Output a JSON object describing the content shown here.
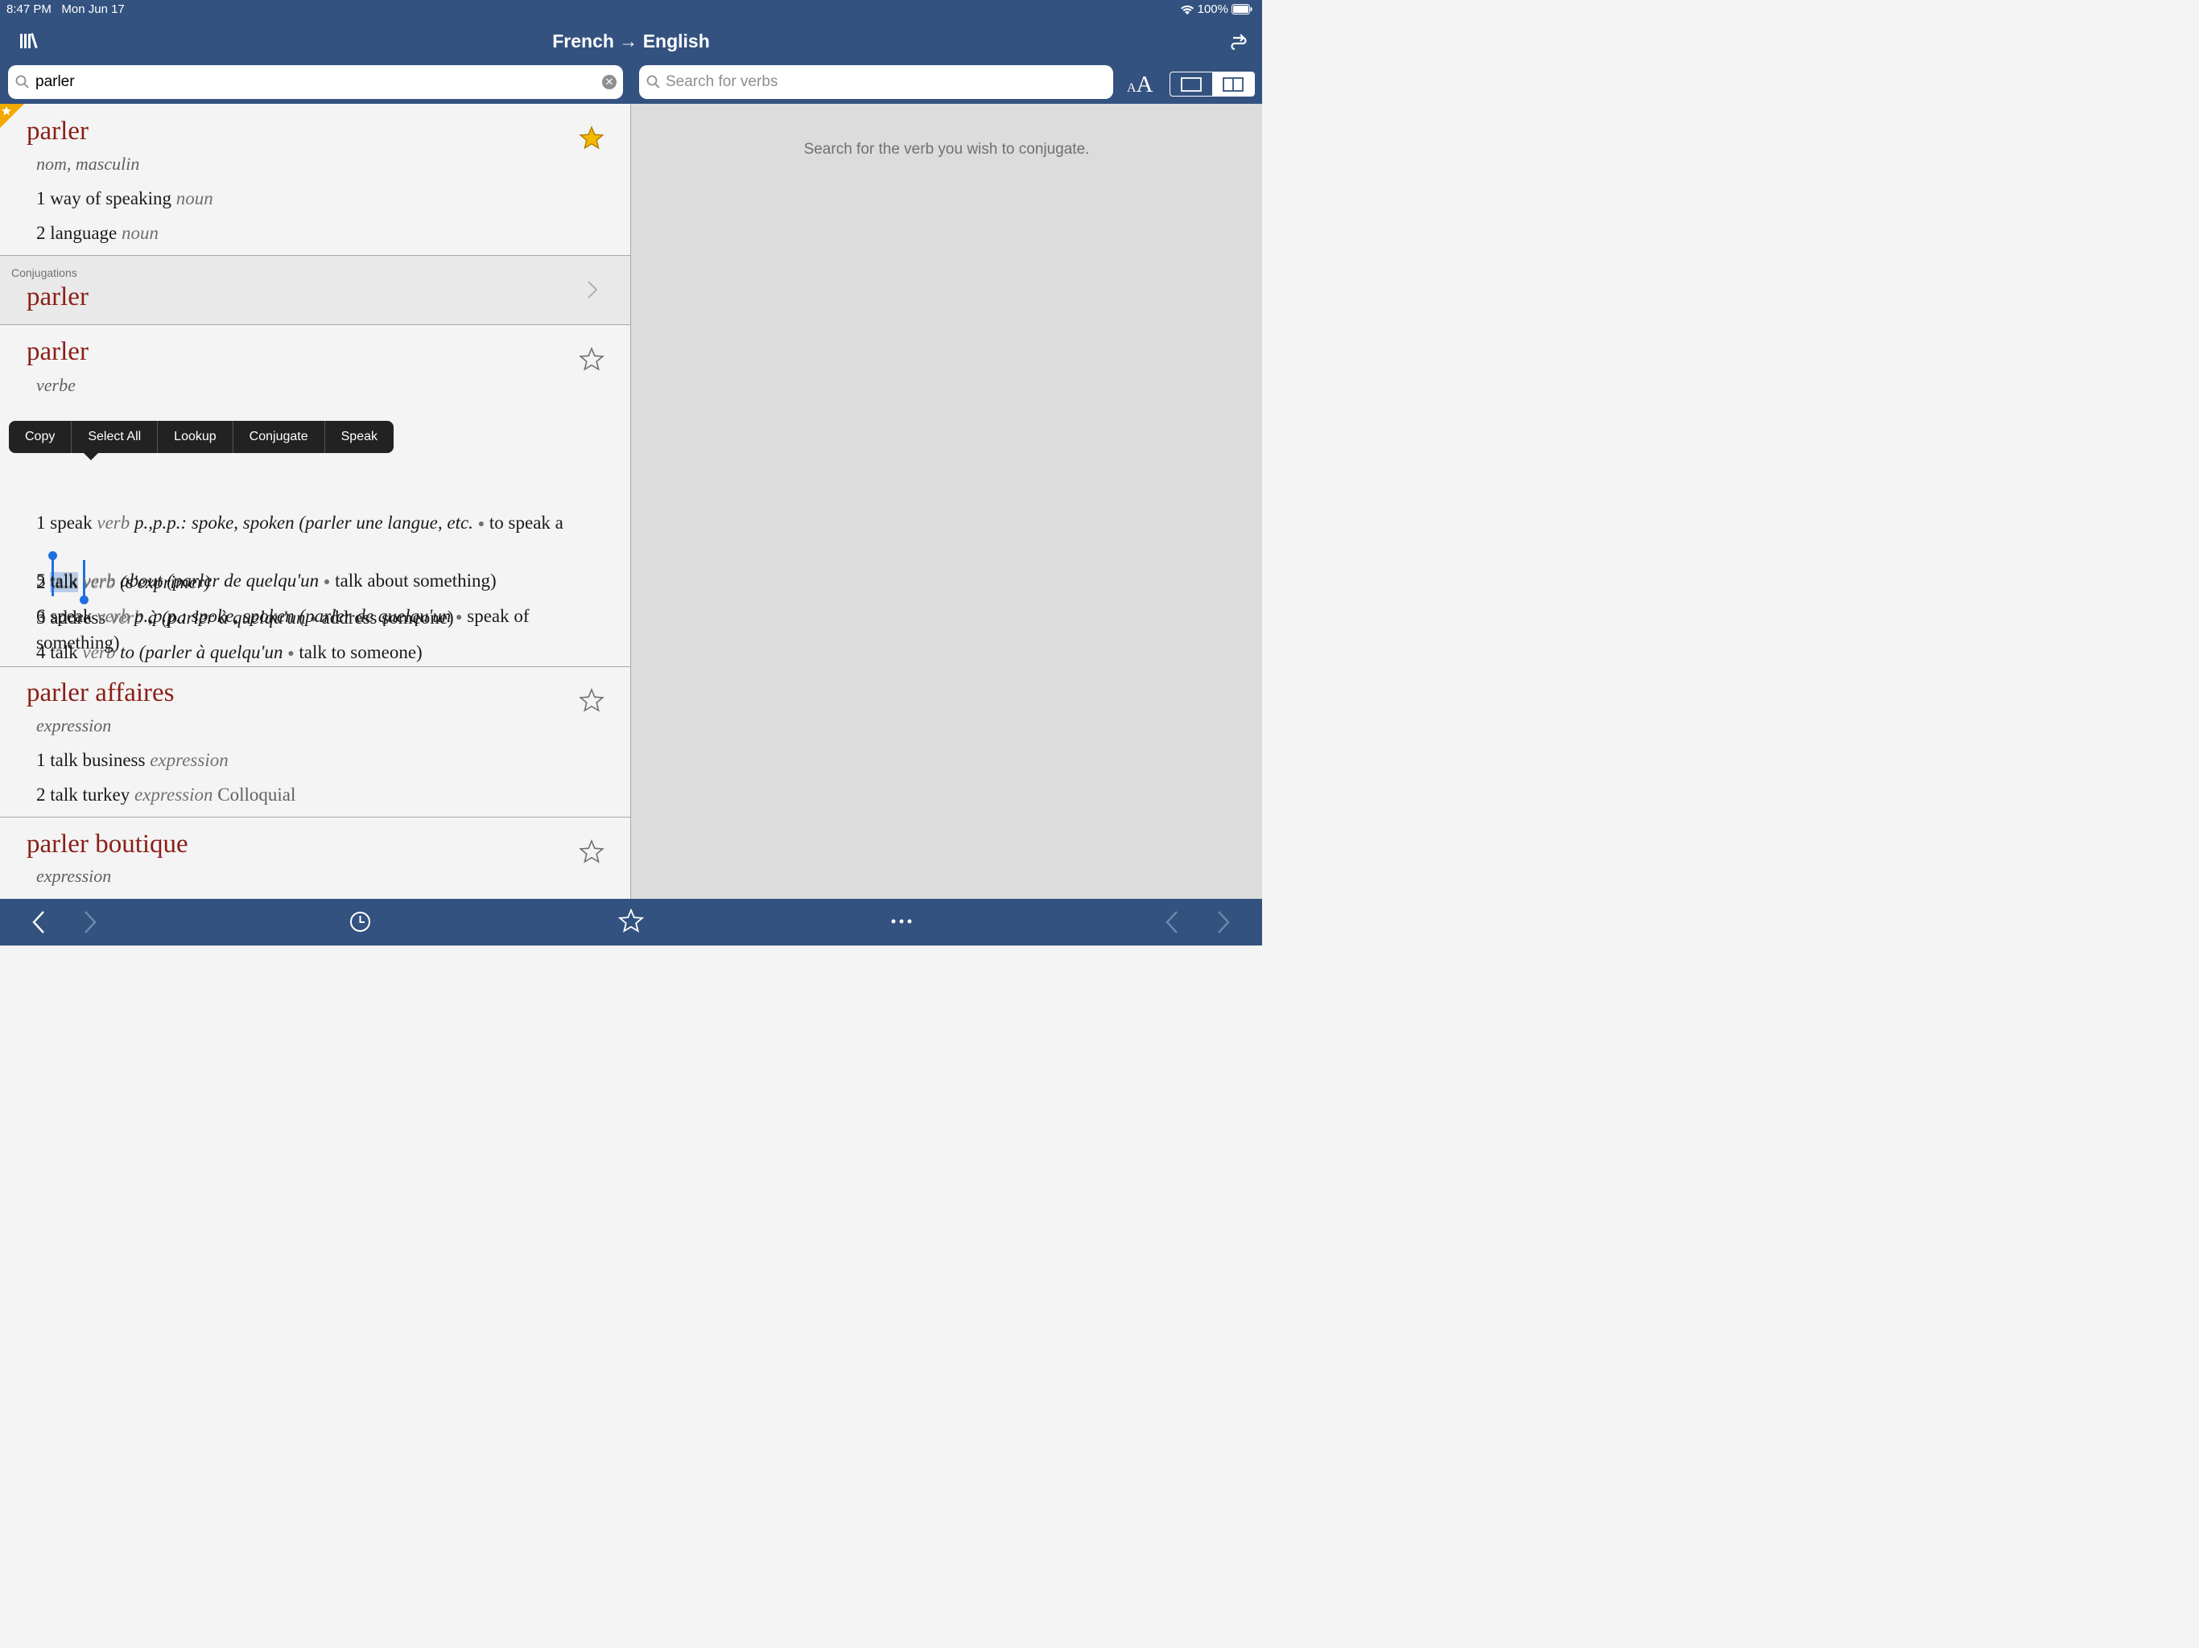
{
  "status": {
    "time": "8:47 PM",
    "date": "Mon Jun 17",
    "battery": "100%"
  },
  "header": {
    "title": "French → English"
  },
  "search": {
    "query": "parler",
    "verb_placeholder": "Search for verbs"
  },
  "textsize": {
    "small": "A",
    "big": "A"
  },
  "right_pane": {
    "hint": "Search for the verb you wish to conjugate."
  },
  "entries": [
    {
      "headword": "parler",
      "pos": "nom, masculin",
      "favorited": true,
      "senses": [
        {
          "num": "1",
          "word": "way of speaking",
          "type": "noun"
        },
        {
          "num": "2",
          "word": "language",
          "type": "noun"
        }
      ]
    },
    {
      "headword": "parler",
      "pos": "verbe",
      "favorited": false,
      "senses": [
        {
          "num": "1",
          "word": "speak",
          "type": "verb",
          "extra": "p.,p.p.: spoke, spoken",
          "example_fr": "(parler une langue, etc.",
          "example_en": "to speak a"
        },
        {
          "num": "2",
          "word": "talk",
          "type": "verb",
          "example_fr": "(s'exprimer)"
        },
        {
          "num": "3",
          "word": "address",
          "type": "verb",
          "prep": "à",
          "example_fr": "(parler à quelqu'un",
          "example_en": "address someone)"
        },
        {
          "num": "4",
          "word": "talk",
          "type": "verb",
          "prep": "to",
          "example_fr": "(parler à quelqu'un",
          "example_en": "talk to someone)"
        },
        {
          "num": "5",
          "word": "talk",
          "type": "verb",
          "prep": "about",
          "example_fr": "(parler de quelqu'un",
          "example_en": "talk about something)"
        },
        {
          "num": "6",
          "word": "speak",
          "type": "verb",
          "extra": "p.,p.p.: spoke, spoken",
          "example_fr": "(parler de quelqu'un",
          "example_en": "speak of something)"
        }
      ]
    },
    {
      "headword": "parler affaires",
      "pos": "expression",
      "favorited": false,
      "senses": [
        {
          "num": "1",
          "word": "talk business",
          "type": "expression"
        },
        {
          "num": "2",
          "word": "talk turkey",
          "type": "expression",
          "label": "Colloquial"
        }
      ]
    },
    {
      "headword": "parler boutique",
      "pos": "expression",
      "favorited": false
    }
  ],
  "conjugations": {
    "label": "Conjugations",
    "verb": "parler"
  },
  "context_menu": {
    "items": [
      "Copy",
      "Select All",
      "Lookup",
      "Conjugate",
      "Speak"
    ]
  },
  "colors": {
    "bar": "#33527f",
    "headword": "#8b1e16",
    "star_filled": "#f5b800",
    "selection": "#1f6ee0"
  },
  "icons": [
    "library-icon",
    "swap-direction-icon",
    "search-icon",
    "clear-icon",
    "star-icon",
    "chevron-right-icon",
    "back-icon",
    "forward-icon",
    "history-icon",
    "favorites-icon",
    "more-icon",
    "prev-icon",
    "next-icon"
  ]
}
